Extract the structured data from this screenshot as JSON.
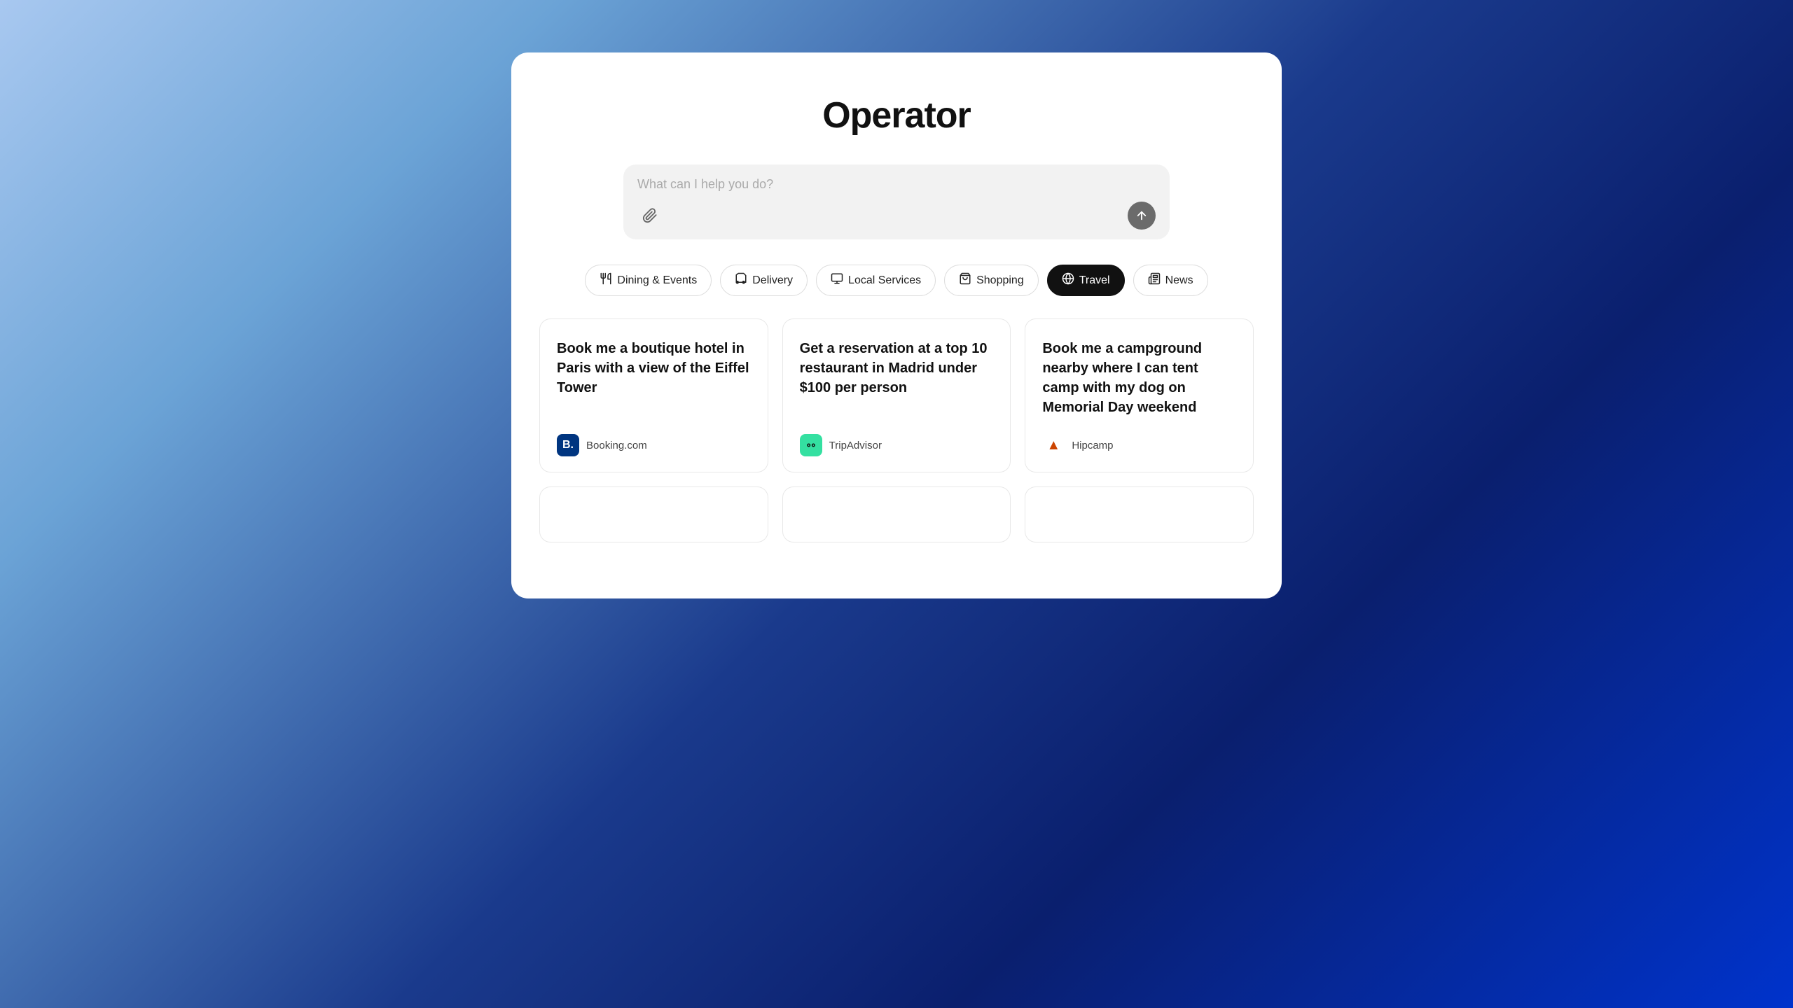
{
  "app": {
    "title": "Operator"
  },
  "search": {
    "placeholder": "What can I help you do?"
  },
  "categories": [
    {
      "id": "dining",
      "label": "Dining & Events",
      "icon": "🍽",
      "active": false
    },
    {
      "id": "delivery",
      "label": "Delivery",
      "icon": "🛵",
      "active": false
    },
    {
      "id": "local",
      "label": "Local Services",
      "icon": "🏠",
      "active": false
    },
    {
      "id": "shopping",
      "label": "Shopping",
      "icon": "🛍",
      "active": false
    },
    {
      "id": "travel",
      "label": "Travel",
      "icon": "🌐",
      "active": true
    },
    {
      "id": "news",
      "label": "News",
      "icon": "📰",
      "active": false
    }
  ],
  "cards": [
    {
      "id": "card1",
      "text": "Book me a boutique hotel in Paris with a view of the Eiffel Tower",
      "service_name": "Booking.com",
      "logo_type": "booking"
    },
    {
      "id": "card2",
      "text": "Get a reservation at a top 10 restaurant in Madrid under $100 per person",
      "service_name": "TripAdvisor",
      "logo_type": "tripadvisor"
    },
    {
      "id": "card3",
      "text": "Book me a campground nearby where I can tent camp with my dog on Memorial Day weekend",
      "service_name": "Hipcamp",
      "logo_type": "hipcamp"
    }
  ],
  "icons": {
    "attach": "📎",
    "send": "↑",
    "booking_letter": "B.",
    "tripadvisor_symbol": "◎◎",
    "hipcamp_symbol": "▲"
  }
}
